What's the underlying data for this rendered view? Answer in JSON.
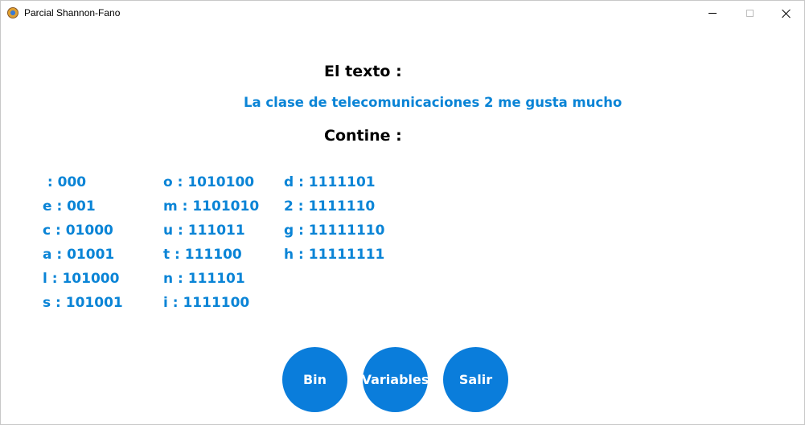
{
  "window": {
    "title": "Parcial Shannon-Fano"
  },
  "main": {
    "text_heading": "El texto :",
    "text_value": "La clase de telecomunicaciones 2 me gusta mucho",
    "contains_heading": "Contine :"
  },
  "codes": {
    "column1": [
      " : 000",
      "e : 001",
      "c : 01000",
      "a : 01001",
      "l : 101000",
      "s : 101001"
    ],
    "column2": [
      "o : 1010100",
      "m : 1101010",
      "u : 111011",
      "t : 111100",
      "n : 111101",
      "i : 1111100"
    ],
    "column3": [
      "d : 1111101",
      "2 : 1111110",
      "g : 11111110",
      "h : 11111111"
    ]
  },
  "buttons": {
    "bin_label": "Bin",
    "variables_label": "Variables",
    "salir_label": "Salir"
  },
  "colors": {
    "accent_text": "#0a84d6",
    "button_fill": "#0a7ddb"
  }
}
